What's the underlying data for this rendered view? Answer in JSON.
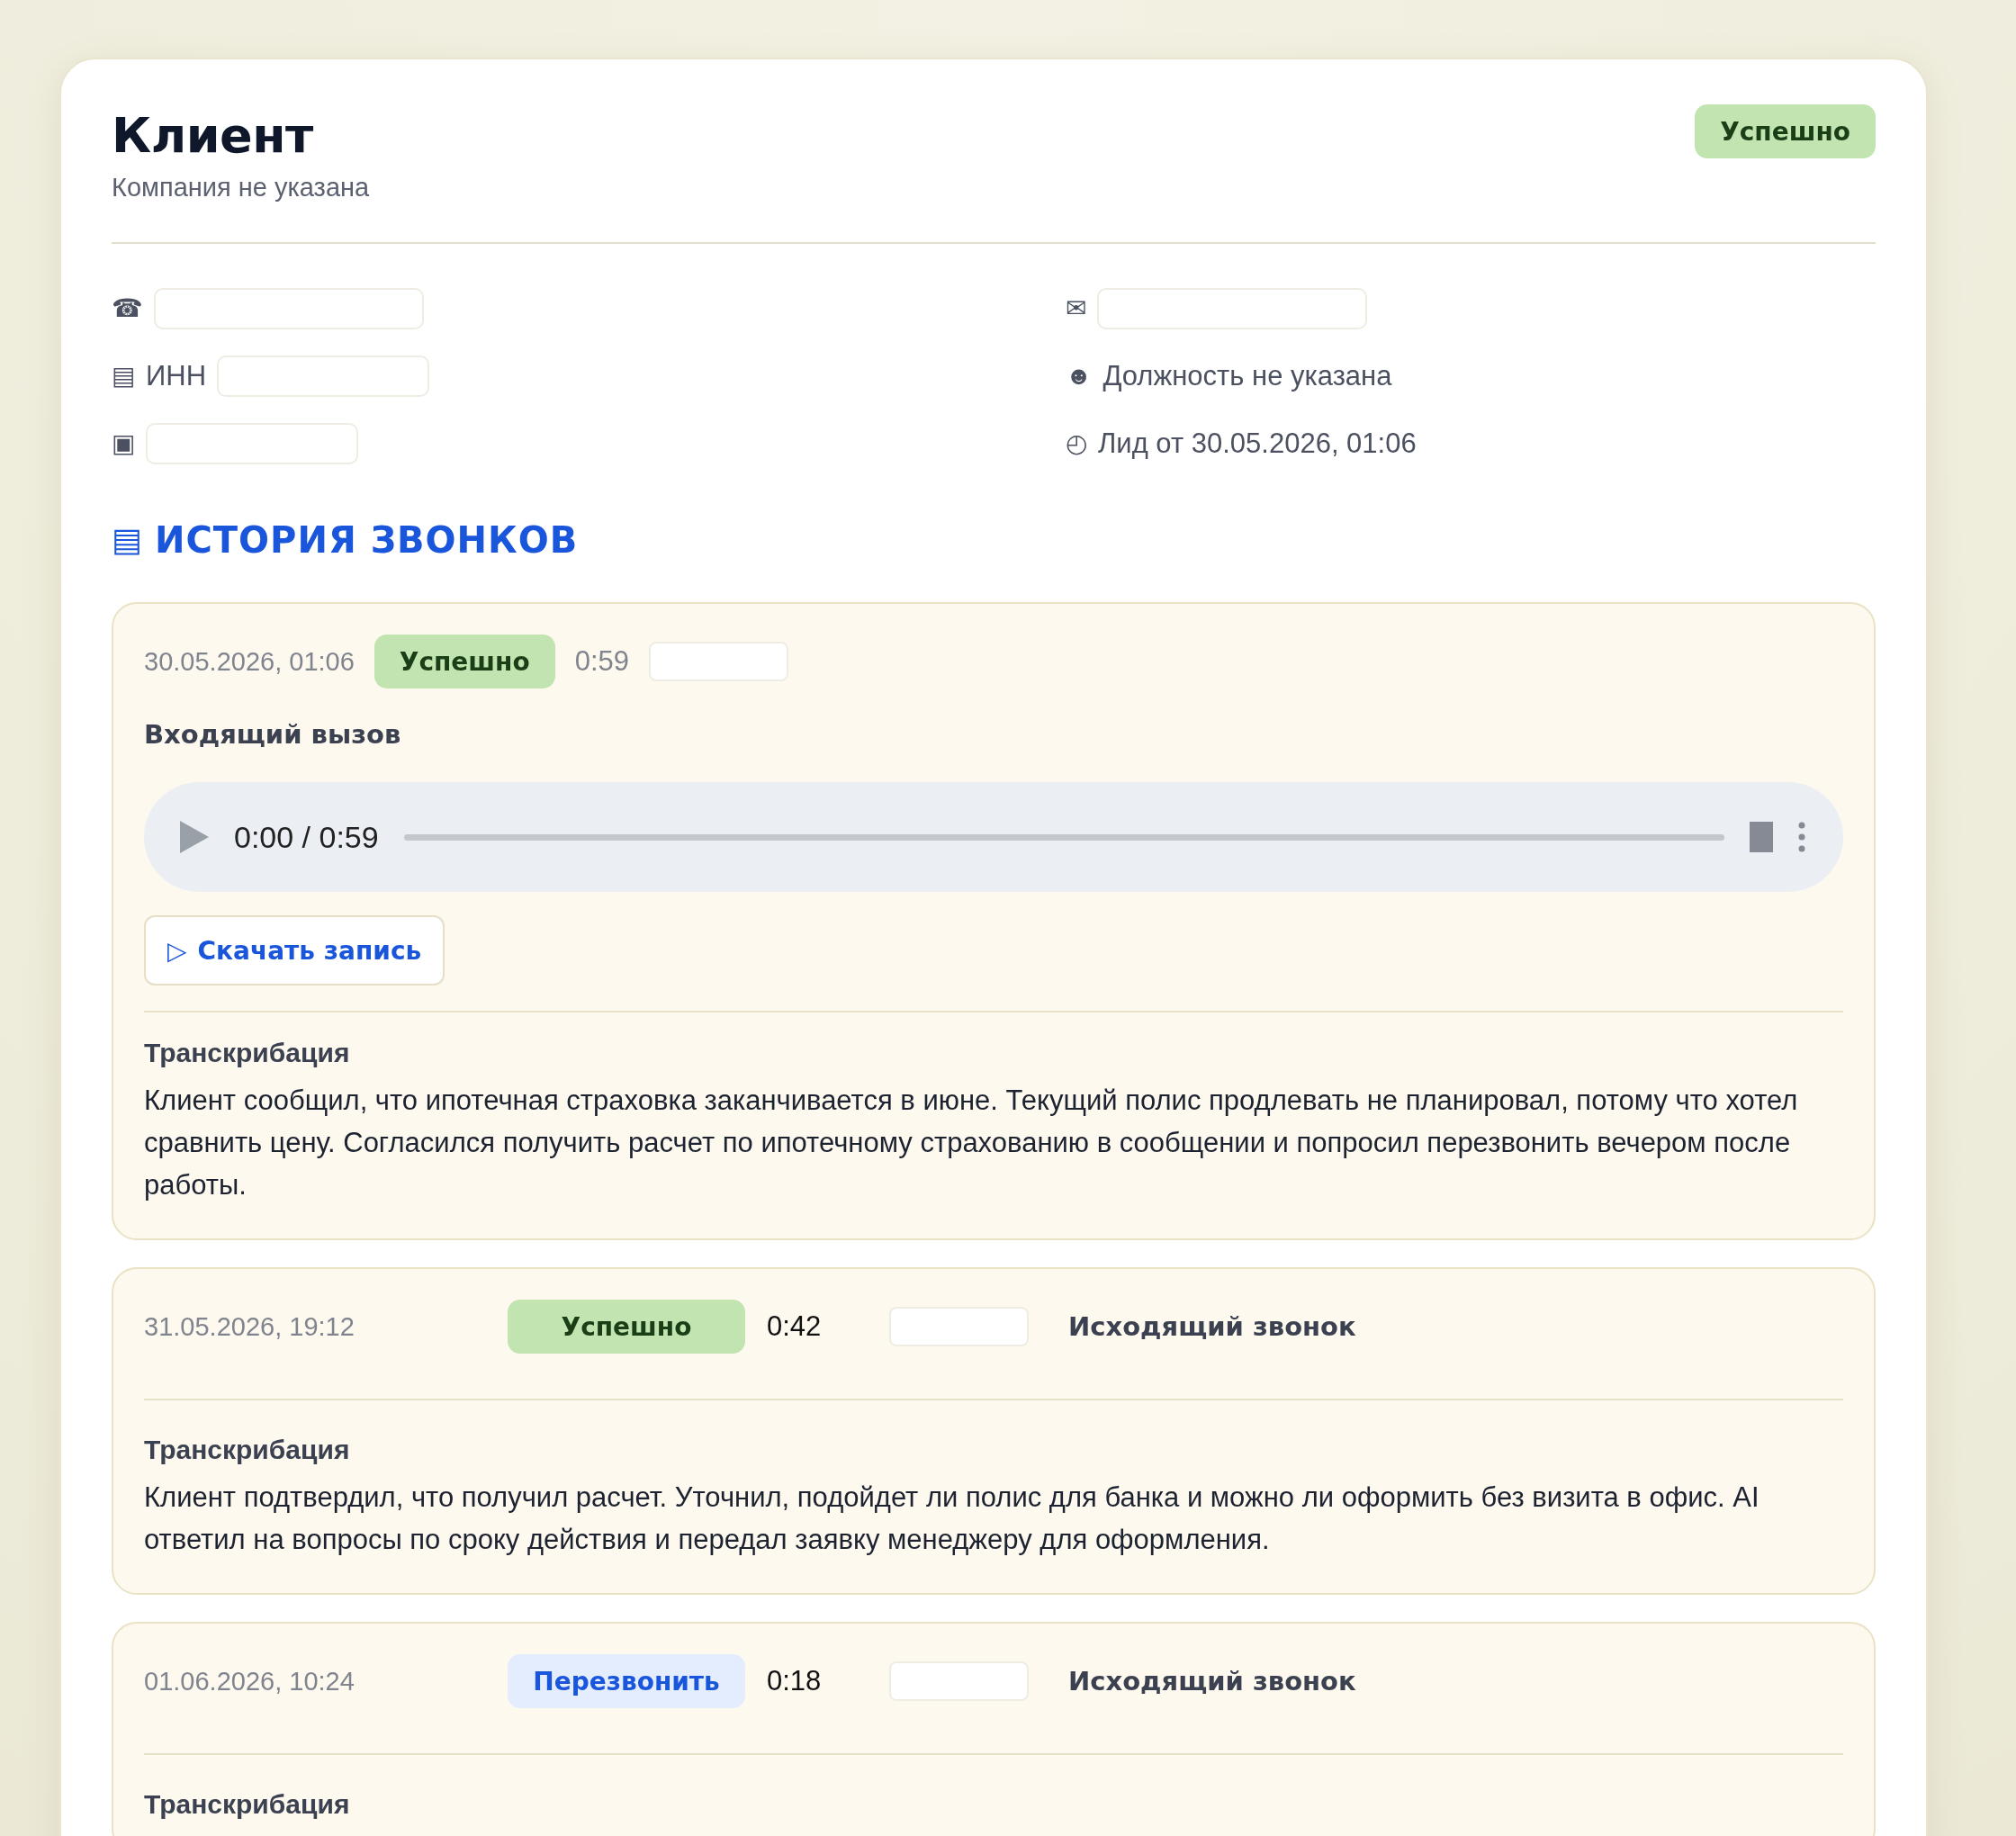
{
  "header": {
    "title": "Клиент",
    "subtitle": "Компания не указана",
    "status": {
      "label": "Успешно",
      "kind": "success"
    }
  },
  "contacts": {
    "left": [
      {
        "icon": "☎"
      },
      {
        "icon": "▤",
        "label": "ИНН"
      },
      {
        "icon": "▣"
      }
    ],
    "right": [
      {
        "icon": "✉",
        "kind": "field"
      },
      {
        "icon": "☻",
        "text": "Должность не указана",
        "kind": "text"
      },
      {
        "icon": "◴",
        "text": "Лид от 30.05.2026, 01:06",
        "kind": "text"
      }
    ]
  },
  "history": {
    "icon": "▤",
    "title": "ИСТОРИЯ ЗВОНКОВ",
    "calls": [
      {
        "kind": "detailed",
        "date": "30.05.2026, 01:06",
        "status": {
          "label": "Успешно",
          "kind": "success"
        },
        "duration": "0:59",
        "direction": "Входящий вызов",
        "player": {
          "time": "0:00 / 0:59",
          "level": 0
        },
        "download": {
          "icon": "▷",
          "label": "Скачать запись"
        },
        "transcript_title": "Транскрибация",
        "transcript": "Клиент сообщил, что ипотечная страховка заканчивается в июне. Текущий полис продлевать не планировал, потому что хотел сравнить цену. Согласился получить расчет по ипотечному страхованию в сообщении и попросил перезвонить вечером после работы."
      },
      {
        "kind": "summary",
        "date": "31.05.2026, 19:12",
        "status": {
          "label": "Успешно",
          "kind": "success"
        },
        "duration": "0:42",
        "direction": "Исходящий звонок",
        "transcript_title": "Транскрибация",
        "transcript": "Клиент подтвердил, что получил расчет. Уточнил, подойдет ли полис для банка и можно ли оформить без визита в офис. AI ответил на вопросы по сроку действия и передал заявку менеджеру для оформления."
      },
      {
        "kind": "summary",
        "date": "01.06.2026, 10:24",
        "status": {
          "label": "Перезвонить",
          "kind": "callback"
        },
        "duration": "0:18",
        "direction": "Исходящий звонок",
        "transcript_title": "Транскрибация"
      }
    ]
  }
}
